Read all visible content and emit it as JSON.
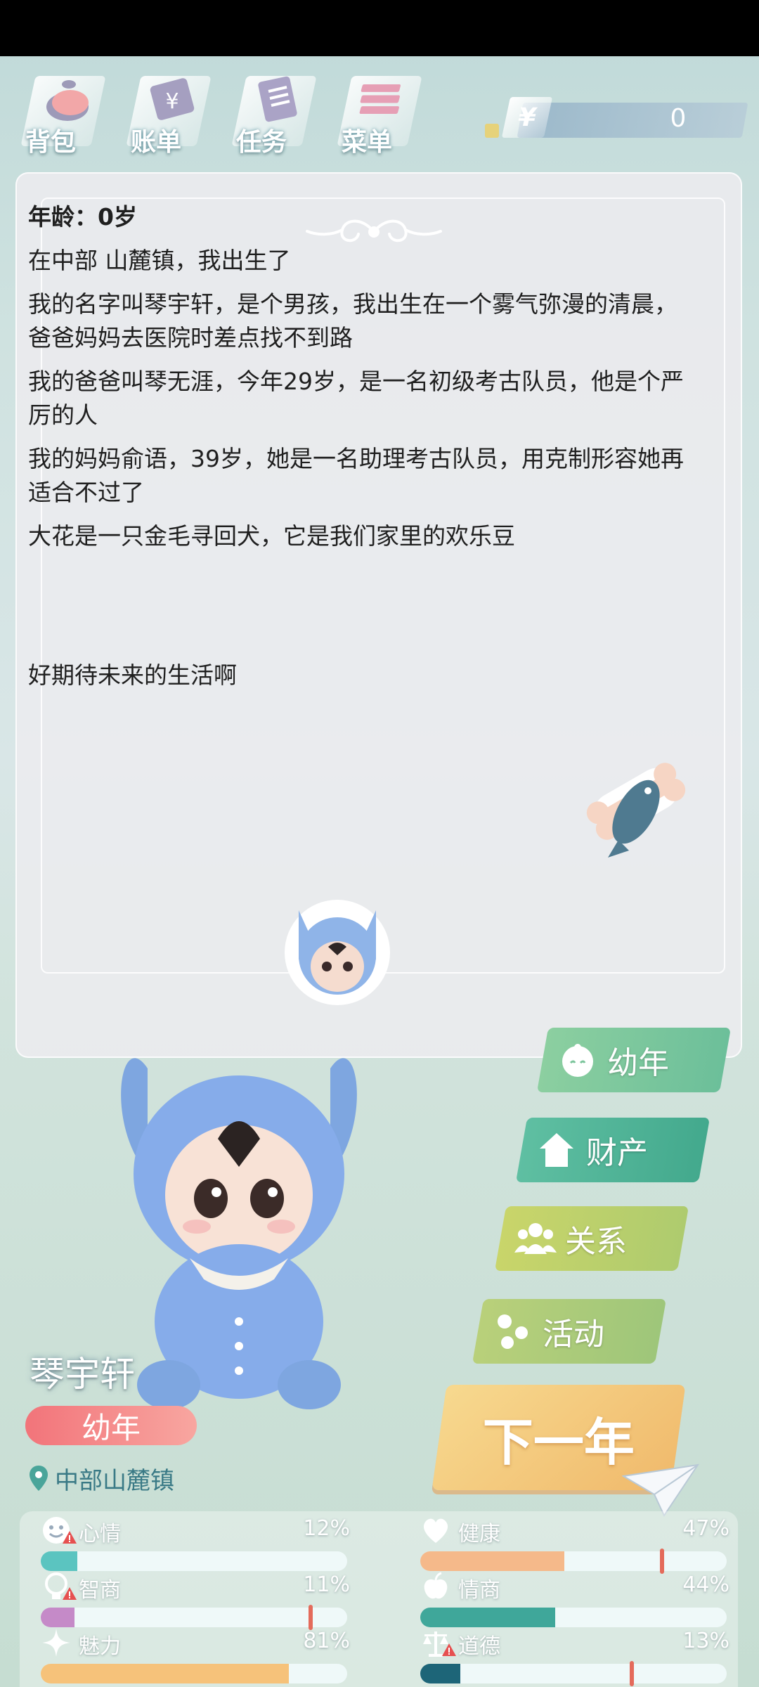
{
  "top_menu": {
    "items": [
      {
        "label": "背包",
        "icon": "bag-icon"
      },
      {
        "label": "账单",
        "icon": "bill-icon"
      },
      {
        "label": "任务",
        "icon": "task-icon"
      },
      {
        "label": "菜单",
        "icon": "menu-icon"
      }
    ]
  },
  "money": {
    "symbol": "¥",
    "value": "0"
  },
  "story": {
    "age_line": "年龄：0岁",
    "paragraphs": [
      "在中部 山麓镇，我出生了",
      "我的名字叫琴宇轩，是个男孩，我出生在一个雾气弥漫的清晨，爸爸妈妈去医院时差点找不到路",
      "我的爸爸叫琴无涯，今年29岁，是一名初级考古队员，他是个严厉的人",
      "我的妈妈俞语，39岁，她是一名助理考古队员，用克制形容她再适合不过了",
      "大花是一只金毛寻回犬，它是我们家里的欢乐豆"
    ],
    "closing": "好期待未来的生活啊"
  },
  "character": {
    "name": "琴宇轩",
    "stage": "幼年",
    "location": "中部山麓镇"
  },
  "actions": {
    "youth": "幼年",
    "assets": "财产",
    "relations": "关系",
    "activities": "活动",
    "next_year": "下一年"
  },
  "stats": [
    {
      "name": "心情",
      "value": "12%",
      "percent": 12,
      "color": "#5bc4c0",
      "warning": true
    },
    {
      "name": "健康",
      "value": "47%",
      "percent": 47,
      "color": "#f5b98a",
      "warning": false,
      "marker": 79
    },
    {
      "name": "智商",
      "value": "11%",
      "percent": 11,
      "color": "#c58ac8",
      "warning": true,
      "marker": 88
    },
    {
      "name": "情商",
      "value": "44%",
      "percent": 44,
      "color": "#3fa79a",
      "warning": false
    },
    {
      "name": "魅力",
      "value": "81%",
      "percent": 81,
      "color": "#f6c27a",
      "warning": false
    },
    {
      "name": "道德",
      "value": "13%",
      "percent": 13,
      "color": "#1d6578",
      "warning": true,
      "marker": 69
    }
  ]
}
